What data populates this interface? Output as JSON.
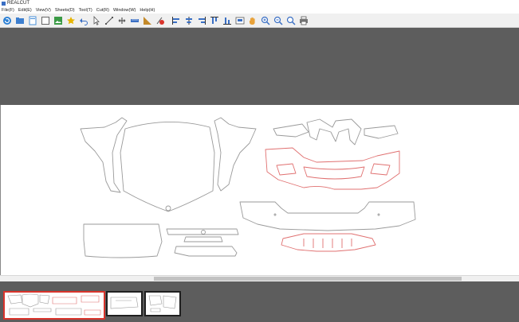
{
  "app": {
    "title": "REALCUT"
  },
  "menu": {
    "items": [
      {
        "label": "File(F)"
      },
      {
        "label": "Edit(E)"
      },
      {
        "label": "View(V)"
      },
      {
        "label": "Sheets(D)"
      },
      {
        "label": "Tool(T)"
      },
      {
        "label": "Cut(R)"
      },
      {
        "label": "Window(W)"
      },
      {
        "label": "Help(H)"
      }
    ]
  },
  "toolbar": {
    "buttons": [
      {
        "name": "refresh-icon",
        "color": "#2a7fd4"
      },
      {
        "name": "open-icon",
        "color": "#3d7fcf"
      },
      {
        "name": "new-icon",
        "color": "#4a90d9"
      },
      {
        "name": "blank-page-icon",
        "color": "#666666"
      },
      {
        "name": "import-image-icon",
        "color": "#3a9a45"
      },
      {
        "name": "star-icon",
        "color": "#e6b400"
      },
      {
        "name": "undo-icon",
        "color": "#3a6fc4"
      },
      {
        "name": "pointer-icon",
        "color": "#555555"
      },
      {
        "name": "node-edit-icon",
        "color": "#555555"
      },
      {
        "name": "transform-icon",
        "color": "#555555"
      },
      {
        "name": "measure-icon",
        "color": "#3a6fc4"
      },
      {
        "name": "triangle-ruler-icon",
        "color": "#c48a2a"
      },
      {
        "name": "delete-node-icon",
        "color": "#d9342c"
      },
      {
        "name": "align-left-icon",
        "color": "#3a6fc4"
      },
      {
        "name": "align-center-icon",
        "color": "#3a6fc4"
      },
      {
        "name": "align-right-icon",
        "color": "#3a6fc4"
      },
      {
        "name": "align-top-icon",
        "color": "#3a6fc4"
      },
      {
        "name": "align-bottom-icon",
        "color": "#3a6fc4"
      },
      {
        "name": "distribute-icon",
        "color": "#3a6fc4"
      },
      {
        "name": "pan-hand-icon",
        "color": "#e8a23a"
      },
      {
        "name": "zoom-in-icon",
        "color": "#3a6fc4"
      },
      {
        "name": "zoom-out-icon",
        "color": "#3a6fc4"
      },
      {
        "name": "zoom-fit-icon",
        "color": "#3a6fc4"
      },
      {
        "name": "print-icon",
        "color": "#555555"
      }
    ]
  },
  "canvas": {
    "background": "#ffffff",
    "outline_color": "#9a9a9a",
    "highlight_color": "#e07070"
  },
  "thumbnails": [
    {
      "name": "sheet-thumbnail-1",
      "active": true
    },
    {
      "name": "sheet-thumbnail-2",
      "active": false
    },
    {
      "name": "sheet-thumbnail-3",
      "active": false
    }
  ]
}
